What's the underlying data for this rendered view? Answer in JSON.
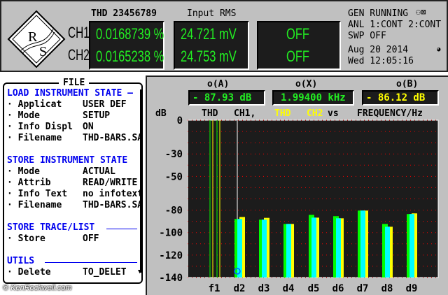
{
  "header": {
    "thd_title": "THD 23456789",
    "rms_title": "Input RMS",
    "ch1_label": "CH1",
    "ch2_label": "CH2",
    "ch1_thd": "0.0168739 %",
    "ch2_thd": "0.0165238 %",
    "ch1_rms": "24.721 mV",
    "ch2_rms": "24.753 mV",
    "ch1_third": "OFF",
    "ch2_third": "OFF"
  },
  "status": {
    "gen": "GEN RUNNING",
    "anl": "ANL 1:CONT 2:CONT",
    "swp": "SWP OFF",
    "date": "Aug 20 2014",
    "time": "Wed 12:05:16"
  },
  "file_panel": {
    "title": "FILE",
    "load_header": "LOAD INSTRUMENT STATE —",
    "load_items": [
      {
        "k": "Applicat",
        "v": "USER DEF"
      },
      {
        "k": "Mode",
        "v": "SETUP"
      },
      {
        "k": "Info Displ",
        "v": "ON"
      },
      {
        "k": "Filename",
        "v": "THD-BARS.SA"
      }
    ],
    "store_header": "STORE INSTRUMENT STATE",
    "store_items": [
      {
        "k": "Mode",
        "v": "ACTUAL"
      },
      {
        "k": "Attrib",
        "v": "READ/WRITE"
      },
      {
        "k": "Info Text",
        "v": "no infotext"
      },
      {
        "k": "Filename",
        "v": "THD-BARS.SA"
      }
    ],
    "trace_header": "STORE TRACE/LIST",
    "trace_items": [
      {
        "k": "Store",
        "v": "OFF"
      }
    ],
    "utils_header": "UTILS",
    "utils_items": [
      {
        "k": "Delete",
        "v": "TO_DELET"
      }
    ]
  },
  "watermark": "© KenRockwell.com",
  "readouts": {
    "a_label": "o(A)",
    "a_value": "- 87.93 dB",
    "x_label": "o(X)",
    "x_value": "1.99400 kHz",
    "b_label": "o(B)",
    "b_value": "- 86.12 dB"
  },
  "chart_data": {
    "type": "bar",
    "ylabel": "dB",
    "title_parts": [
      "THD",
      "CH1,",
      "THD",
      "CH2",
      "vs",
      "FREQUENCY/Hz"
    ],
    "ylim": [
      -140,
      0
    ],
    "yticks": [
      0,
      -30,
      -50,
      -80,
      -100,
      -120,
      -140
    ],
    "grid": true,
    "categories": [
      "f1",
      "d2",
      "d3",
      "d4",
      "d5",
      "d6",
      "d7",
      "d8",
      "d9"
    ],
    "series": [
      {
        "name": "THD CH1",
        "color": "#00ff00",
        "values": [
          0,
          -87.9,
          -88.5,
          -92.3,
          -84.2,
          -85.4,
          -80.4,
          -92.3,
          -83.5
        ]
      },
      {
        "name": "THD CH2",
        "color": "#ffff00",
        "values": [
          0,
          -86.1,
          -86.9,
          -92.3,
          -86.7,
          -87.3,
          -80.4,
          -94.8,
          -82.9
        ]
      }
    ],
    "marker_category": "d2"
  },
  "colors": {
    "green": "#22ee22",
    "yellow": "#ffff00",
    "cyan": "#00ffff",
    "blue": "#0000ee",
    "panel": "#c0c0c0"
  }
}
